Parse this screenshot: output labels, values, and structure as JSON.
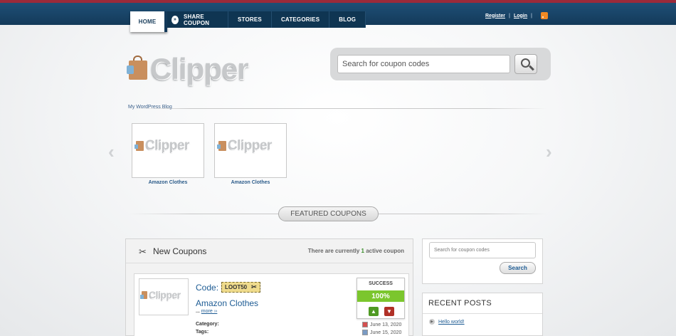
{
  "nav": {
    "home": "HOME",
    "share": "SHARE COUPON",
    "stores": "STORES",
    "categories": "CATEGORIES",
    "blog": "BLOG"
  },
  "top_links": {
    "register": "Register",
    "login": "Login",
    "rss_icon": "rss-icon"
  },
  "logo": {
    "text": "Clipper"
  },
  "search": {
    "placeholder": "Search for coupon codes"
  },
  "tagline": "My WordPress Blog",
  "slider": {
    "items": [
      {
        "logo_text": "Clipper",
        "caption": "Amazon Clothes"
      },
      {
        "logo_text": "Clipper",
        "caption": "Amazon Clothes"
      }
    ]
  },
  "featured": {
    "label": "FEATURED COUPONS"
  },
  "new_coupons": {
    "title": "New Coupons",
    "note_prefix": "There are currently",
    "count": "1",
    "note_suffix": "active coupon"
  },
  "coupon": {
    "thumb_text": "Clipper",
    "code_label": "Code:",
    "code": "LOOT50",
    "title": "Amazon Clothes",
    "more_prefix": "...",
    "more": "more ››",
    "category_label": "Category:",
    "tags_label": "Tags:",
    "success_label": "SUCCESS",
    "success_pct": "100%",
    "date_start": "June 13, 2020",
    "date_end": "June 15, 2020"
  },
  "sidebar": {
    "search_placeholder": "Search for coupon codes",
    "search_button": "Search",
    "recent_title": "RECENT POSTS",
    "recent_items": [
      "Hello world!"
    ]
  },
  "colors": {
    "topbar": "#1e4f76",
    "accent_link": "#1e5c94",
    "success_green": "#7bc62d"
  }
}
